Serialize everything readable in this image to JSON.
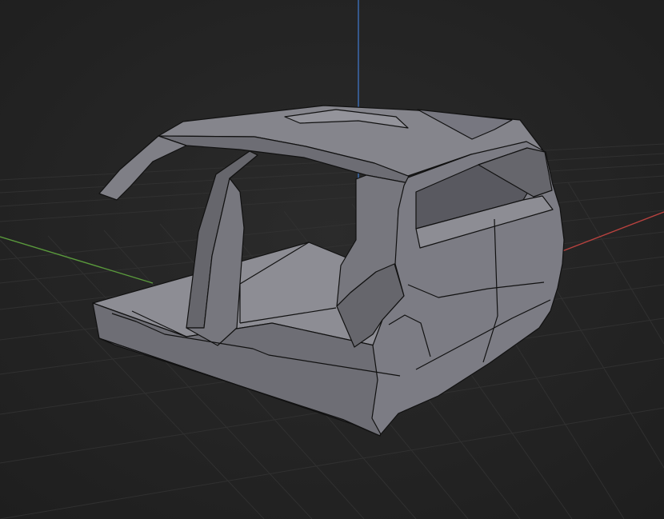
{
  "viewport": {
    "kind": "3d-viewport",
    "object": "car-body-shell-mesh",
    "view": "perspective",
    "grid_visible": true,
    "axes_visible": [
      "x",
      "y",
      "z"
    ]
  },
  "colors": {
    "background": "#242424",
    "grid_minor": "#2e2e2e",
    "grid_major": "#383838",
    "axis_x": "#b8423f",
    "axis_y": "#5a9a3c",
    "axis_z": "#3d6fb8",
    "mesh_light": "#8a8a91",
    "mesh_mid": "#737379",
    "mesh_dark": "#5b5b61",
    "mesh_outline": "#111111"
  }
}
